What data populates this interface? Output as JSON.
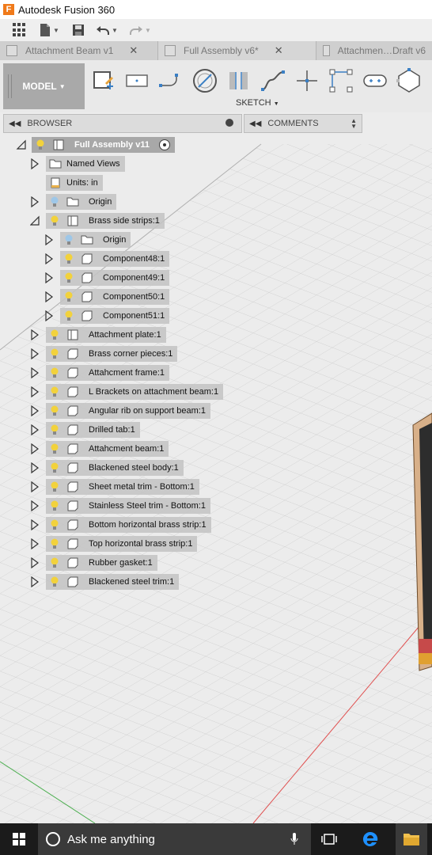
{
  "app": {
    "title": "Autodesk Fusion 360",
    "icon_letter": "F"
  },
  "tabs": [
    {
      "label": "Attachment Beam v1",
      "closable": true
    },
    {
      "label": "Full Assembly v6*",
      "closable": true
    },
    {
      "label": "Attachmen…Draft v6",
      "closable": false
    }
  ],
  "toolbar": {
    "workspace_label": "MODEL",
    "sketch_label": "SKETCH"
  },
  "browser": {
    "title": "BROWSER",
    "root_label": "Full Assembly v11",
    "items": [
      {
        "label": "Named Views"
      },
      {
        "label": "Units: in"
      },
      {
        "label": "Origin"
      },
      {
        "label": "Brass side strips:1"
      },
      {
        "label": "Origin"
      },
      {
        "label": "Component48:1"
      },
      {
        "label": "Component49:1"
      },
      {
        "label": "Component50:1"
      },
      {
        "label": "Component51:1"
      },
      {
        "label": "Attachment plate:1"
      },
      {
        "label": "Brass corner pieces:1"
      },
      {
        "label": "Attahcment frame:1"
      },
      {
        "label": "L Brackets on attachment beam:1"
      },
      {
        "label": "Angular rib on support beam:1"
      },
      {
        "label": "Drilled tab:1"
      },
      {
        "label": "Attahcment beam:1"
      },
      {
        "label": "Blackened steel body:1"
      },
      {
        "label": "Sheet metal trim - Bottom:1"
      },
      {
        "label": "Stainless Steel trim - Bottom:1"
      },
      {
        "label": "Bottom horizontal brass strip:1"
      },
      {
        "label": "Top horizontal brass strip:1"
      },
      {
        "label": "Rubber gasket:1"
      },
      {
        "label": "Blackened steel trim:1"
      }
    ]
  },
  "comments": {
    "title": "COMMENTS"
  },
  "taskbar": {
    "search_placeholder": "Ask me anything"
  },
  "colors": {
    "bulb": "#f2d23c",
    "bulb_off": "#9ec7e8",
    "accent": "#f07a1a",
    "axis_red": "#e05050",
    "axis_green": "#4caf50"
  }
}
